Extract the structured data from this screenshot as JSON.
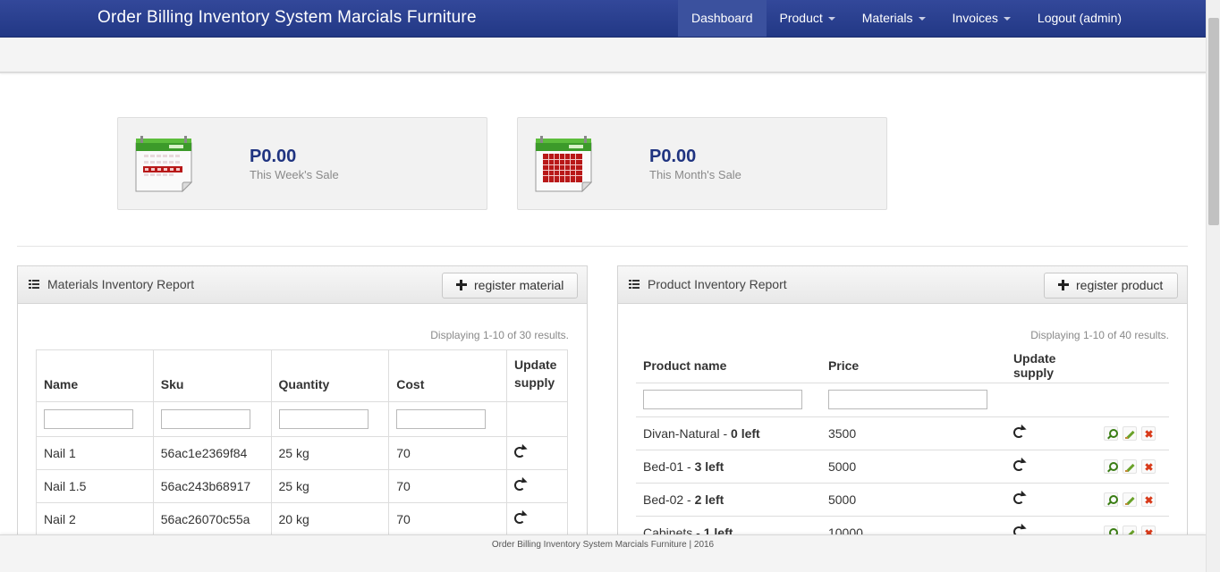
{
  "app": {
    "title": "Order Billing Inventory System Marcials Furniture"
  },
  "nav": {
    "items": [
      {
        "label": "Dashboard",
        "active": true,
        "dropdown": false
      },
      {
        "label": "Product",
        "dropdown": true
      },
      {
        "label": "Materials",
        "dropdown": true
      },
      {
        "label": "Invoices",
        "dropdown": true
      },
      {
        "label": "Logout (admin)",
        "dropdown": false
      }
    ]
  },
  "stats": [
    {
      "value": "P0.00",
      "label": "This Week's Sale",
      "icon": "calendar-week-icon"
    },
    {
      "value": "P0.00",
      "label": "This Month's Sale",
      "icon": "calendar-month-icon"
    }
  ],
  "materials_panel": {
    "title": "Materials Inventory Report",
    "button_label": "register material",
    "summary": "Displaying 1-10 of 30 results.",
    "columns": [
      "Name",
      "Sku",
      "Quantity",
      "Cost",
      "Update supply"
    ],
    "rows": [
      {
        "name": "Nail 1",
        "sku": "56ac1e2369f84",
        "quantity": "25 kg",
        "cost": "70"
      },
      {
        "name": "Nail 1.5",
        "sku": "56ac243b68917",
        "quantity": "25 kg",
        "cost": "70"
      },
      {
        "name": "Nail 2",
        "sku": "56ac26070c55a",
        "quantity": "20 kg",
        "cost": "70"
      }
    ]
  },
  "products_panel": {
    "title": "Product Inventory Report",
    "button_label": "register product",
    "summary": "Displaying 1-10 of 40 results.",
    "columns": [
      "Product name",
      "Price",
      "Update supply"
    ],
    "rows": [
      {
        "name": "Divan-Natural",
        "stock": "0 left",
        "price": "3500"
      },
      {
        "name": "Bed-01",
        "stock": "3 left",
        "price": "5000"
      },
      {
        "name": "Bed-02",
        "stock": "2 left",
        "price": "5000"
      },
      {
        "name": "Cabinets",
        "stock": "1 left",
        "price": "10000"
      }
    ],
    "separator": " - "
  },
  "footer": {
    "text": "Order Billing Inventory System Marcials Furniture | 2016"
  },
  "colors": {
    "navbar": "#223885",
    "stat_value": "#1f3380"
  }
}
